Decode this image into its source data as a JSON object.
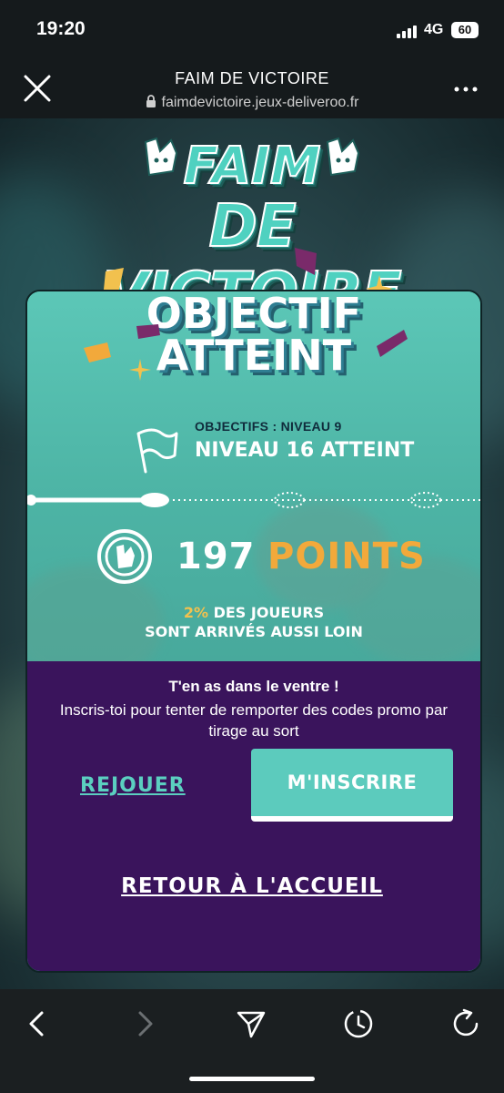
{
  "status_bar": {
    "time": "19:20",
    "network": "4G",
    "battery": "60"
  },
  "browser": {
    "title": "FAIM DE VICTOIRE",
    "url": "faimdevictoire.jeux-deliveroo.fr"
  },
  "logo": {
    "line1": "FAIM",
    "line2": "DE VICTOIRE"
  },
  "result": {
    "title_line1": "OBJECTIF",
    "title_line2": "ATTEINT",
    "objective_label": "OBJECTIFS : NIVEAU 9",
    "level_reached": "NIVEAU 16 ATTEINT",
    "points_value": "197",
    "points_label": "POINTS",
    "percent": "2%",
    "percent_text_line1": "DES JOUEURS",
    "percent_text_line2": "SONT ARRIVÉS AUSSI LOIN"
  },
  "cta": {
    "title": "T'en as dans le ventre !",
    "description": "Inscris-toi pour tenter de remporter des codes promo par tirage au sort",
    "replay_label": "REJOUER",
    "signup_label": "M'INSCRIRE"
  },
  "back_home_label": "RETOUR À L'ACCUEIL",
  "colors": {
    "teal": "#5ccbbd",
    "purple": "#3a145c",
    "orange": "#f2a93b"
  }
}
